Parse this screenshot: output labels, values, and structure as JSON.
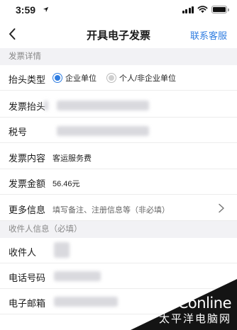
{
  "status_bar": {
    "time": "3:59",
    "location_icon": "location-arrow-icon",
    "signal_icon": "cellular-signal-icon",
    "wifi_icon": "wifi-icon",
    "battery_icon": "battery-icon"
  },
  "nav": {
    "back_icon": "chevron-left-icon",
    "title": "开具电子发票",
    "action_label": "联系客服",
    "action_color": "#2f7de1"
  },
  "invoice_section": {
    "header": "发票详情",
    "title_type": {
      "label": "抬头类型",
      "options": [
        {
          "label": "企业单位",
          "selected": true
        },
        {
          "label": "个人/非企业单位",
          "selected": false
        }
      ]
    },
    "invoice_title": {
      "label": "发票抬头"
    },
    "tax_number": {
      "label": "税号"
    },
    "content": {
      "label": "发票内容",
      "value": "客运服务费"
    },
    "amount": {
      "label": "发票金额",
      "value": "56.46元"
    },
    "more_info": {
      "label": "更多信息",
      "placeholder": "填写备注、注册信息等（非必填）",
      "chevron_icon": "chevron-right-icon"
    }
  },
  "recipient_section": {
    "header": "收件人信息（必填）",
    "name": {
      "label": "收件人"
    },
    "phone": {
      "label": "电话号码"
    },
    "email": {
      "label": "电子邮箱"
    }
  },
  "watermark": {
    "logo": "PConline",
    "subtitle": "太平洋电脑网"
  }
}
